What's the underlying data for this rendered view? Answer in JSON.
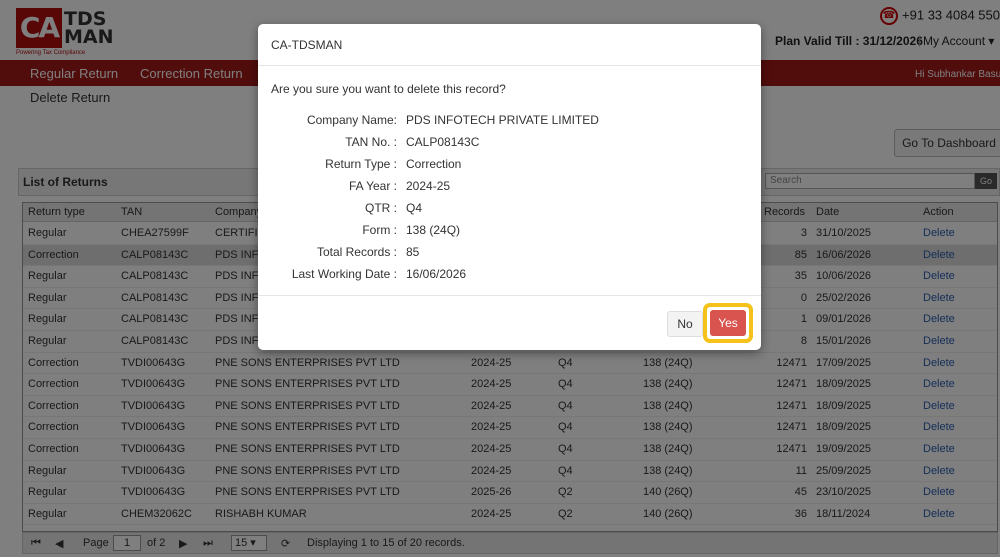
{
  "brand": {
    "logo_mark": "CA",
    "logo_text_1": "TDS",
    "logo_text_2": "MAN",
    "tagline": "Powering Tax Compliance"
  },
  "header": {
    "phone": "+91 33 4084 550",
    "plan_valid": "Plan Valid Till : 31/12/2026",
    "separator": "|",
    "account": "My Account",
    "greeting": "Hi Subhankar Basu"
  },
  "nav": {
    "items": [
      "Regular Return",
      "Correction Return"
    ],
    "sub": "Delete Return"
  },
  "toolbar": {
    "dashboard": "Go To Dashboard",
    "list_title": "List of Returns",
    "search_placeholder": "Search",
    "go": "Go"
  },
  "grid": {
    "columns": [
      "Return type",
      "TAN",
      "Company",
      "Records",
      "Date",
      "Action"
    ],
    "rows": [
      {
        "type": "Regular",
        "tan": "CHEA27599F",
        "company": "CERTIFIC",
        "fy": "",
        "qtr": "",
        "form": "",
        "records": "3",
        "date": "31/10/2025",
        "action": "Delete"
      },
      {
        "type": "Correction",
        "tan": "CALP08143C",
        "company": "PDS INFO",
        "fy": "",
        "qtr": "",
        "form": "",
        "records": "85",
        "date": "16/06/2026",
        "action": "Delete"
      },
      {
        "type": "Regular",
        "tan": "CALP08143C",
        "company": "PDS INFO",
        "fy": "",
        "qtr": "",
        "form": "",
        "records": "35",
        "date": "10/06/2026",
        "action": "Delete"
      },
      {
        "type": "Regular",
        "tan": "CALP08143C",
        "company": "PDS INFO",
        "fy": "",
        "qtr": "",
        "form": "",
        "records": "0",
        "date": "25/02/2026",
        "action": "Delete"
      },
      {
        "type": "Regular",
        "tan": "CALP08143C",
        "company": "PDS INFO",
        "fy": "",
        "qtr": "",
        "form": "",
        "records": "1",
        "date": "09/01/2026",
        "action": "Delete"
      },
      {
        "type": "Regular",
        "tan": "CALP08143C",
        "company": "PDS INFO",
        "fy": "",
        "qtr": "",
        "form": "",
        "records": "8",
        "date": "15/01/2026",
        "action": "Delete"
      },
      {
        "type": "Correction",
        "tan": "TVDI00643G",
        "company": "PNE SONS ENTERPRISES PVT LTD",
        "fy": "2024-25",
        "qtr": "Q4",
        "form": "138 (24Q)",
        "records": "12471",
        "date": "17/09/2025",
        "action": "Delete"
      },
      {
        "type": "Correction",
        "tan": "TVDI00643G",
        "company": "PNE SONS ENTERPRISES PVT LTD",
        "fy": "2024-25",
        "qtr": "Q4",
        "form": "138 (24Q)",
        "records": "12471",
        "date": "18/09/2025",
        "action": "Delete"
      },
      {
        "type": "Correction",
        "tan": "TVDI00643G",
        "company": "PNE SONS ENTERPRISES PVT LTD",
        "fy": "2024-25",
        "qtr": "Q4",
        "form": "138 (24Q)",
        "records": "12471",
        "date": "18/09/2025",
        "action": "Delete"
      },
      {
        "type": "Correction",
        "tan": "TVDI00643G",
        "company": "PNE SONS ENTERPRISES PVT LTD",
        "fy": "2024-25",
        "qtr": "Q4",
        "form": "138 (24Q)",
        "records": "12471",
        "date": "18/09/2025",
        "action": "Delete"
      },
      {
        "type": "Correction",
        "tan": "TVDI00643G",
        "company": "PNE SONS ENTERPRISES PVT LTD",
        "fy": "2024-25",
        "qtr": "Q4",
        "form": "138 (24Q)",
        "records": "12471",
        "date": "19/09/2025",
        "action": "Delete"
      },
      {
        "type": "Regular",
        "tan": "TVDI00643G",
        "company": "PNE SONS ENTERPRISES PVT LTD",
        "fy": "2024-25",
        "qtr": "Q4",
        "form": "138 (24Q)",
        "records": "11",
        "date": "25/09/2025",
        "action": "Delete"
      },
      {
        "type": "Regular",
        "tan": "TVDI00643G",
        "company": "PNE SONS ENTERPRISES PVT LTD",
        "fy": "2025-26",
        "qtr": "Q2",
        "form": "140 (26Q)",
        "records": "45",
        "date": "23/10/2025",
        "action": "Delete"
      },
      {
        "type": "Regular",
        "tan": "CHEM32062C",
        "company": "RISHABH KUMAR",
        "fy": "2024-25",
        "qtr": "Q2",
        "form": "140 (26Q)",
        "records": "36",
        "date": "18/11/2024",
        "action": "Delete"
      }
    ]
  },
  "pager": {
    "page_label": "Page",
    "page": "1",
    "of": "of 2",
    "page_size": "15",
    "status": "Displaying 1 to 15 of 20 records."
  },
  "modal": {
    "title": "CA-TDSMAN",
    "question": "Are you sure you want to delete this record?",
    "fields": [
      {
        "label": "Company Name:",
        "value": "PDS INFOTECH PRIVATE LIMITED"
      },
      {
        "label": "TAN No. :",
        "value": "CALP08143C"
      },
      {
        "label": "Return Type :",
        "value": "Correction"
      },
      {
        "label": "FA Year :",
        "value": "2024-25"
      },
      {
        "label": "QTR :",
        "value": "Q4"
      },
      {
        "label": "Form :",
        "value": "138 (24Q)"
      },
      {
        "label": "Total Records :",
        "value": "85"
      },
      {
        "label": "Last Working Date :",
        "value": "16/06/2026"
      }
    ],
    "no": "No",
    "yes": "Yes"
  },
  "colors": {
    "brand_red": "#a31818",
    "danger": "#d9534f",
    "highlight": "#f4c21a",
    "link": "#2a5db0"
  },
  "icons": [
    "phone-icon",
    "chevron-down-icon",
    "first-page-icon",
    "prev-page-icon",
    "next-page-icon",
    "last-page-icon",
    "refresh-icon"
  ]
}
